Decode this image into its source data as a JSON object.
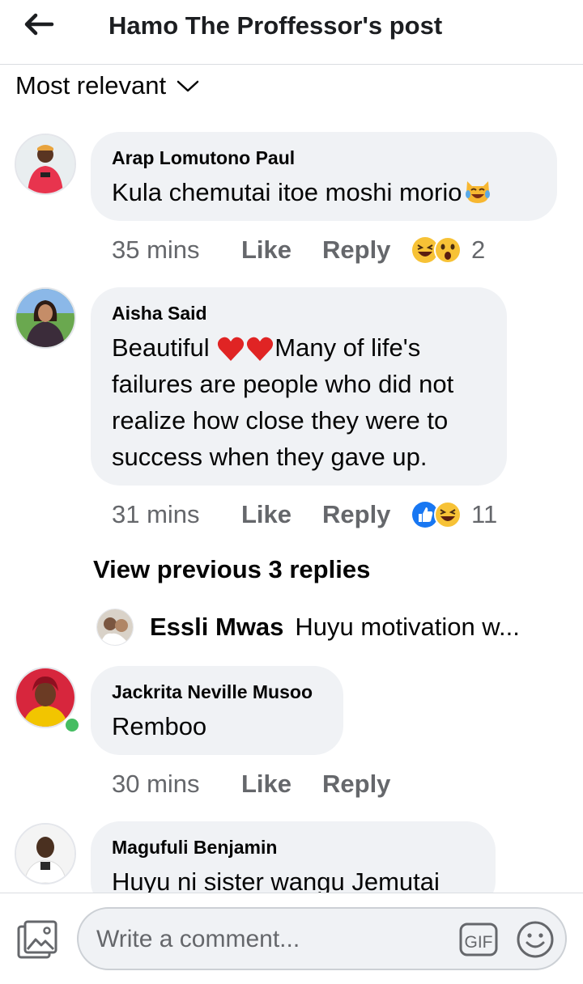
{
  "header": {
    "title": "Hamo The Proffessor's post",
    "back_icon": "arrow-left-icon"
  },
  "sort": {
    "label": "Most relevant",
    "icon": "chevron-down-icon"
  },
  "comments": [
    {
      "author": "Arap Lomutono Paul",
      "text": "Kula chemutai itoe moshi morio",
      "emoji": "laughing-cat-emoji",
      "time": "35 mins",
      "like": "Like",
      "reply": "Reply",
      "reactions": [
        "haha",
        "wow"
      ],
      "reaction_count": "2"
    },
    {
      "author": "Aisha Said",
      "text_prefix": "Beautiful",
      "text_suffix": "Many of life's",
      "text_lines": [
        "failures are people who did not",
        "realize how close they were to",
        "success when they gave up."
      ],
      "time": "31 mins",
      "like": "Like",
      "reply": "Reply",
      "reactions": [
        "like",
        "haha"
      ],
      "reaction_count": "11"
    },
    {
      "author": "Jackrita Neville Musoo",
      "text": "Remboo",
      "online": true,
      "time": "30 mins",
      "like": "Like",
      "reply": "Reply"
    },
    {
      "author": "Magufuli Benjamin",
      "text": "Huyu ni sister wangu Jemutai"
    }
  ],
  "view_previous": "View previous 3 replies",
  "reply_preview": {
    "author": "Essli Mwas",
    "snippet": "Huyu motivation w..."
  },
  "composer": {
    "placeholder": "Write a comment...",
    "gif_label": "GIF",
    "photo_icon": "photo-icon",
    "emoji_icon": "smiley-icon"
  }
}
